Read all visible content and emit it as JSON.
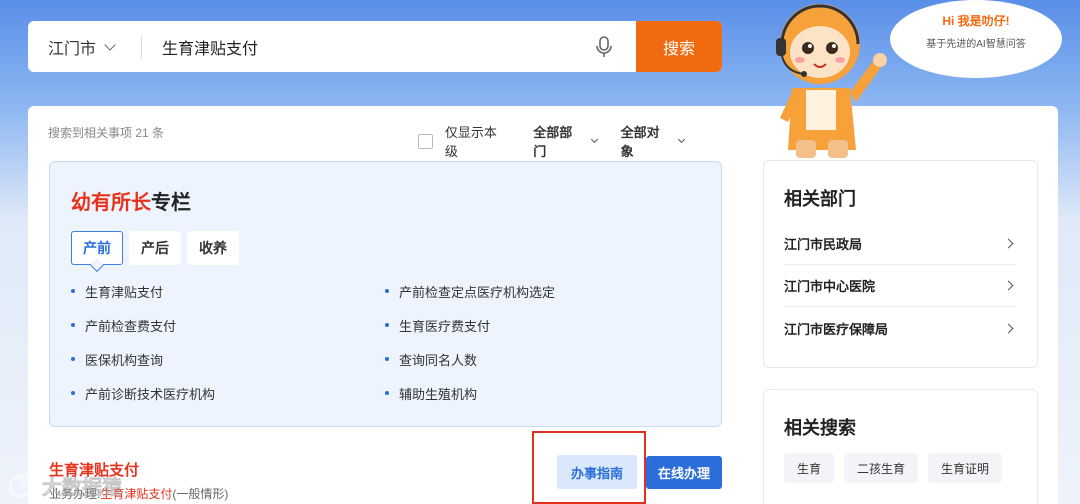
{
  "search": {
    "city": "江门市",
    "query": "生育津贴支付",
    "button_label": "搜索"
  },
  "assistant": {
    "greeting": "Hi 我是叻仔!",
    "tagline": "基于先进的AI智慧问答"
  },
  "results": {
    "count_text": "搜索到相关事项 21 条",
    "filter_checkbox_label": "仅显示本级",
    "filter_dept": "全部部门",
    "filter_target": "全部对象"
  },
  "special": {
    "title_highlight": "幼有所长",
    "title_rest": "专栏",
    "tabs": [
      "产前",
      "产后",
      "收养"
    ],
    "items": [
      "生育津贴支付",
      "产前检查定点医疗机构选定",
      "产前检查费支付",
      "生育医疗费支付",
      "医保机构查询",
      "查询同名人数",
      "产前诊断技术医疗机构",
      "辅助生殖机构"
    ]
  },
  "result_item": {
    "title": "生育津贴支付",
    "sub_prefix": "业务办理:",
    "sub_link": "生育津贴支付",
    "sub_suffix": "(一般情形)",
    "guide_label": "办事指南",
    "online_label": "在线办理"
  },
  "related_depts": {
    "title": "相关部门",
    "items": [
      "江门市民政局",
      "江门市中心医院",
      "江门市医疗保障局"
    ]
  },
  "related_search": {
    "title": "相关搜索",
    "tags": [
      "生育",
      "二孩生育",
      "生育证明"
    ]
  },
  "watermark_text": "大数据猿",
  "colors": {
    "accent_orange": "#f26a10",
    "accent_blue": "#2b6ed9",
    "highlight_red": "#e8311a"
  }
}
